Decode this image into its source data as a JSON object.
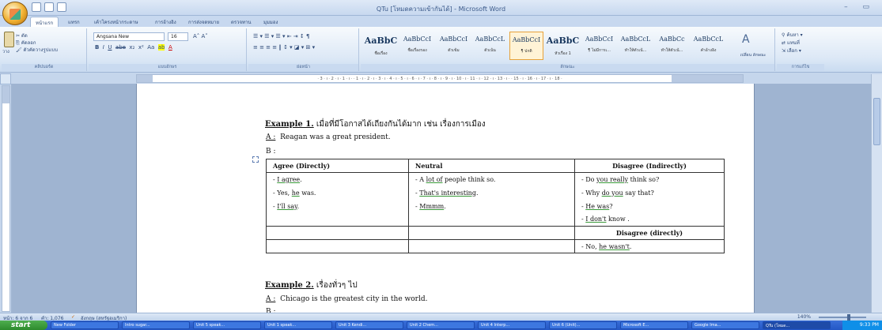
{
  "window": {
    "title": "QTu [โหมดความเข้ากันได้] - Microsoft Word",
    "controls": "– ▭"
  },
  "tabs": [
    "หน้าแรก",
    "แทรก",
    "เค้าโครงหน้ากระดาษ",
    "การอ้างอิง",
    "การส่งจดหมาย",
    "ตรวจทาน",
    "มุมมอง"
  ],
  "ribbon": {
    "clipboard": {
      "paste": "วาง",
      "cut": "✂ ตัด",
      "copy": "⎘ คัดลอก",
      "format_painter": "🖌 ตัวคัดวางรูปแบบ",
      "label": "คลิปบอร์ด"
    },
    "font": {
      "name": "Angsana New",
      "size": "16",
      "grow_shrink": "A˄ A˅",
      "bold": "B",
      "italic": "I",
      "underline": "U",
      "strike": "abe",
      "subscript": "x₂",
      "superscript": "x²",
      "case": "Aa",
      "highlight": "ab",
      "font_color": "A",
      "label": "แบบอักษร"
    },
    "paragraph": {
      "row1": "☰ ▾  ☰ ▾  ☰ ▾   ⇤ ⇥  ↕ ¶",
      "row2": "≡ ≡ ≡ ≡  ‖  ↕ ▾   ◪ ▾  ⊞ ▾",
      "label": "ย่อหน้า"
    },
    "styles": {
      "items": [
        {
          "sample": "AaBbC",
          "name": "ชื่อเรื่อง",
          "big": true
        },
        {
          "sample": "AaBbCcI",
          "name": "ชื่อเรื่องรอง",
          "big": false
        },
        {
          "sample": "AaBbCcI",
          "name": "ตัวเข้ม",
          "big": false
        },
        {
          "sample": "AaBbCcL",
          "name": "ตัวเน้น",
          "big": false
        },
        {
          "sample": "AaBbCcI",
          "name": "¶ ปกติ",
          "big": false,
          "selected": true
        },
        {
          "sample": "AaBbC",
          "name": "หัวเรื่อง 1",
          "big": true
        },
        {
          "sample": "AaBbCcI",
          "name": "¶ ไม่มีการเ...",
          "big": false
        },
        {
          "sample": "AaBbCcL",
          "name": "ทำให้ตัวเน้...",
          "big": false
        },
        {
          "sample": "AaBbCc",
          "name": "ทำให้ตัวเน้...",
          "big": false
        },
        {
          "sample": "AaBbCcL",
          "name": "คำอ้างอิง",
          "big": false
        }
      ],
      "change_styles": "เปลี่ยน ลักษณะ",
      "label": "ลักษณะ"
    },
    "editing": {
      "find": "ค้นหา ▾",
      "replace": "แทนที่",
      "select": "เลือก ▾",
      "label": "การแก้ไข"
    }
  },
  "ruler": {
    "ticks": "· 3 · ı · 2 · ı · 1 · ı ·  · 1 · ı · 2 · ı · 3 · ı · 4 · ı · 5 · ı · 6 · ı · 7 · ı · 8 · ı · 9 · ı · 10 · ı · 11 · ı · 12 · ı · 13 · ı ·  · 15 · ı · 16 · ı · 17 · ı · 18 ·"
  },
  "document": {
    "example1": {
      "label": "Example 1.",
      "title": "เมื่อที่มีโอกาสได้เถียงกันได้มาก เช่น เรื่องการเมือง",
      "a_label": "A :",
      "a_text": "Reagan was a great president.",
      "b_label": "B :"
    },
    "table": {
      "headers": [
        "Agree (Directly)",
        "Neutral",
        "Disagree (Indirectly)"
      ],
      "rows": [
        [
          "- I agree.",
          "- A lot of people think so.",
          "- Do you really think so?"
        ],
        [
          "- Yes, he was.",
          "- That's interesting.",
          "- Why do you say that?"
        ],
        [
          "- I'll say.",
          "- Mmmm.",
          "- He was?"
        ],
        [
          "",
          "",
          "- I don't know ."
        ]
      ],
      "subheader": "Disagree (directly)",
      "last_row": "- No, he wasn't."
    },
    "example2": {
      "label": "Example 2.",
      "title": "เรื่องทั่วๆ ไป",
      "a_label": "A :",
      "a_text": "Chicago is the greatest city in the world.",
      "b_label": "B :"
    }
  },
  "status": {
    "page": "หน้า: 6 จาก 6",
    "words": "คำ: 1,076",
    "language": "อังกฤษ (สหรัฐอเมริกา)",
    "zoom": "140%"
  },
  "taskbar": {
    "start": "start",
    "items": [
      "New Folder",
      "Intro sugar...",
      "Unit 5 speak...",
      "Unit 1 speak...",
      "Unit 3 Kendi...",
      "Unit 2 Chem...",
      "Unit 4 Interp...",
      "Unit 6 (Unit)...",
      "Microsoft E...",
      "Google Ima...",
      "QTu (โหมด..."
    ],
    "clock": "9:33 PM"
  }
}
